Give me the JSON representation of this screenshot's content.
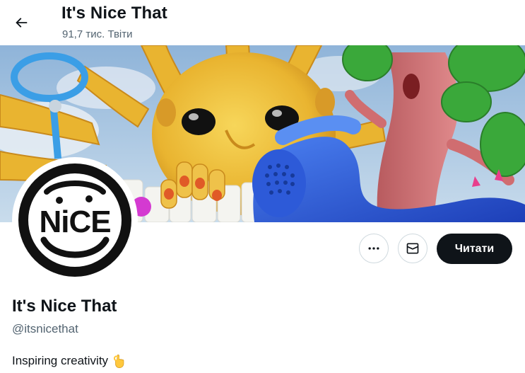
{
  "header": {
    "back_icon": "arrow-left-icon",
    "title": "It's Nice That",
    "post_count": "91,7 тис. Твіти"
  },
  "banner": {
    "description_icon": "banner-image"
  },
  "profile": {
    "avatar_text": "NiCE",
    "display_name": "It's Nice That",
    "handle": "@itsnicethat",
    "bio": "Inspiring creativity",
    "bio_emoji_icon": "ok-hand-icon"
  },
  "actions": {
    "more_icon": "more-horizontal-icon",
    "message_icon": "envelope-icon",
    "follow_label": "Читати"
  },
  "colors": {
    "text_primary": "#0f1419",
    "text_secondary": "#536471",
    "button_border": "#cfd9de",
    "follow_bg": "#0f1419",
    "follow_text": "#ffffff"
  }
}
